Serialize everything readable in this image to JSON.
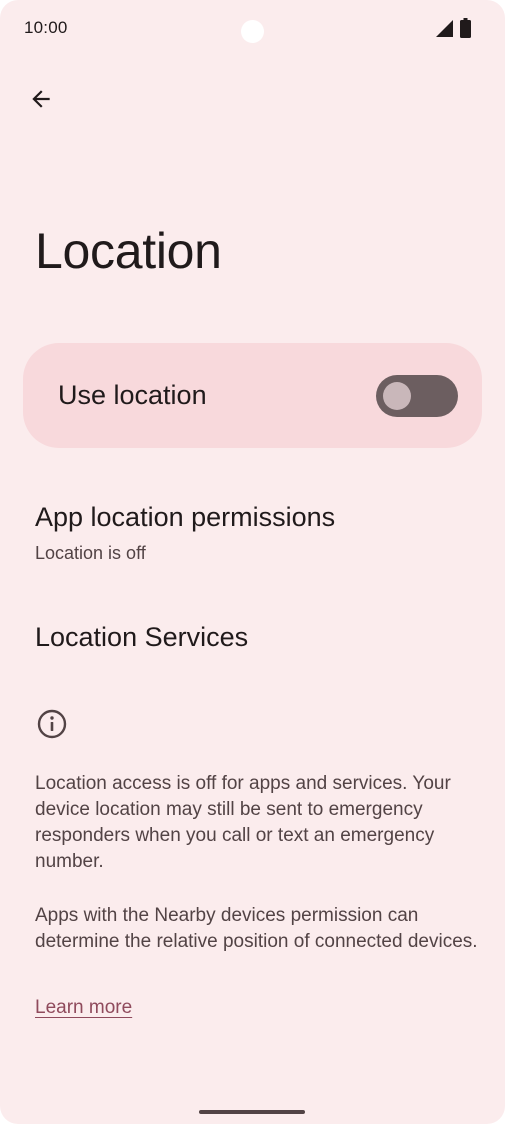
{
  "status_bar": {
    "time": "10:00",
    "signal_icon": "cellular-signal-icon",
    "battery_icon": "battery-icon"
  },
  "toolbar": {
    "back_icon": "arrow-back-icon"
  },
  "page": {
    "title": "Location"
  },
  "main_switch": {
    "label": "Use location",
    "checked": false
  },
  "preferences": [
    {
      "title": "App location permissions",
      "summary": "Location is off"
    },
    {
      "title": "Location Services"
    }
  ],
  "footer": {
    "icon": "info-icon",
    "paragraphs": [
      "Location access is off for apps and services. Your device location may still be sent to emergency responders when you call or text an emergency number.",
      "Apps with the Nearby devices permission can determine the relative position of connected devices."
    ],
    "link_label": "Learn more"
  },
  "colors": {
    "background": "#fbeced",
    "card": "#f8d9dc",
    "toggle_track_off": "#6c5e60",
    "toggle_thumb_off": "#c9b7ba",
    "link": "#8f4a5c",
    "text_primary": "#201a1b",
    "text_secondary": "#524345"
  }
}
